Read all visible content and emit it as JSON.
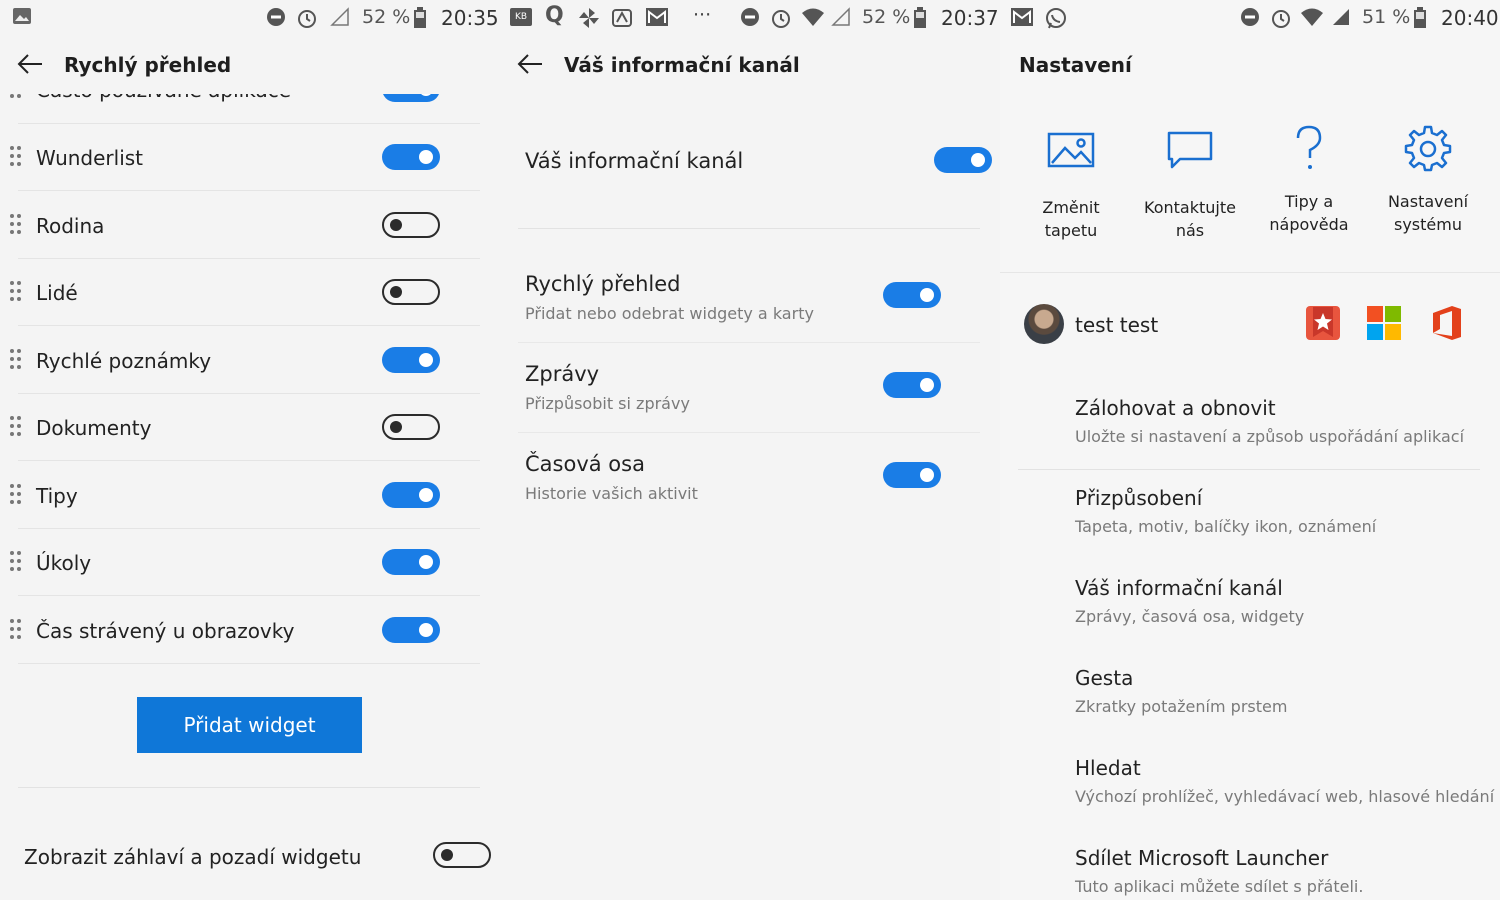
{
  "screen1": {
    "status": {
      "battery_pct": "52 %",
      "time": "20:35"
    },
    "title": "Rychlý přehled",
    "partial_row_label": "Často používané aplikace",
    "rows": [
      {
        "label": "Wunderlist",
        "on": true,
        "chevron": true
      },
      {
        "label": "Rodina",
        "on": false,
        "chevron": false
      },
      {
        "label": "Lidé",
        "on": false,
        "chevron": true
      },
      {
        "label": "Rychlé poznámky",
        "on": true,
        "chevron": false
      },
      {
        "label": "Dokumenty",
        "on": false,
        "chevron": false
      },
      {
        "label": "Tipy",
        "on": true,
        "chevron": false
      },
      {
        "label": "Úkoly",
        "on": true,
        "chevron": true
      },
      {
        "label": "Čas strávený u obrazovky",
        "on": true,
        "chevron": false
      }
    ],
    "add_button": "Přidat widget",
    "bottom_toggle_label": "Zobrazit záhlaví a pozadí widgetu",
    "bottom_toggle_on": false
  },
  "screen2": {
    "status": {
      "battery_pct": "52 %",
      "time": "20:37",
      "overflow": "···"
    },
    "title": "Váš informační kanál",
    "main_toggle_label": "Váš informační kanál",
    "main_toggle_on": true,
    "items": [
      {
        "title": "Rychlý přehled",
        "subtitle": "Přidat nebo odebrat widgety a karty",
        "on": true,
        "chevron": true
      },
      {
        "title": "Zprávy",
        "subtitle": "Přizpůsobit si zprávy",
        "on": true,
        "chevron": true
      },
      {
        "title": "Časová osa",
        "subtitle": "Historie vašich aktivit",
        "on": true,
        "chevron": false
      }
    ]
  },
  "screen3": {
    "status": {
      "battery_pct": "51 %",
      "time": "20:40"
    },
    "title": "Nastavení",
    "quick_actions": [
      {
        "line1": "Změnit",
        "line2": "tapetu",
        "icon": "wallpaper-icon"
      },
      {
        "line1": "Kontaktujte",
        "line2": "nás",
        "icon": "chat-icon"
      },
      {
        "line1": "Tipy a",
        "line2": "nápověda",
        "icon": "help-icon"
      },
      {
        "line1": "Nastavení",
        "line2": "systému",
        "icon": "gear-icon"
      }
    ],
    "user_name": "test test",
    "menu": [
      {
        "title": "Zálohovat a obnovit",
        "subtitle": "Uložte si nastavení a způsob uspořádání aplikací",
        "icon": "cloud-sync-icon"
      },
      {
        "title": "Přizpůsobení",
        "subtitle": "Tapeta, motiv, balíčky ikon, oznámení",
        "icon": "personalize-icon"
      },
      {
        "title": "Váš informační kanál",
        "subtitle": "Zprávy, časová osa, widgety",
        "icon": "feed-window-icon"
      },
      {
        "title": "Gesta",
        "subtitle": "Zkratky potažením prstem",
        "icon": "gesture-icon"
      },
      {
        "title": "Hledat",
        "subtitle": "Výchozí prohlížeč, vyhledávací web, hlasové hledání",
        "icon": "search-icon"
      },
      {
        "title": "Sdílet Microsoft Launcher",
        "subtitle": "Tuto aplikaci můžete sdílet s přáteli.",
        "icon": "share-icon"
      }
    ]
  },
  "colors": {
    "accent": "#0f77d8",
    "toggle_on": "#1a7de6"
  }
}
